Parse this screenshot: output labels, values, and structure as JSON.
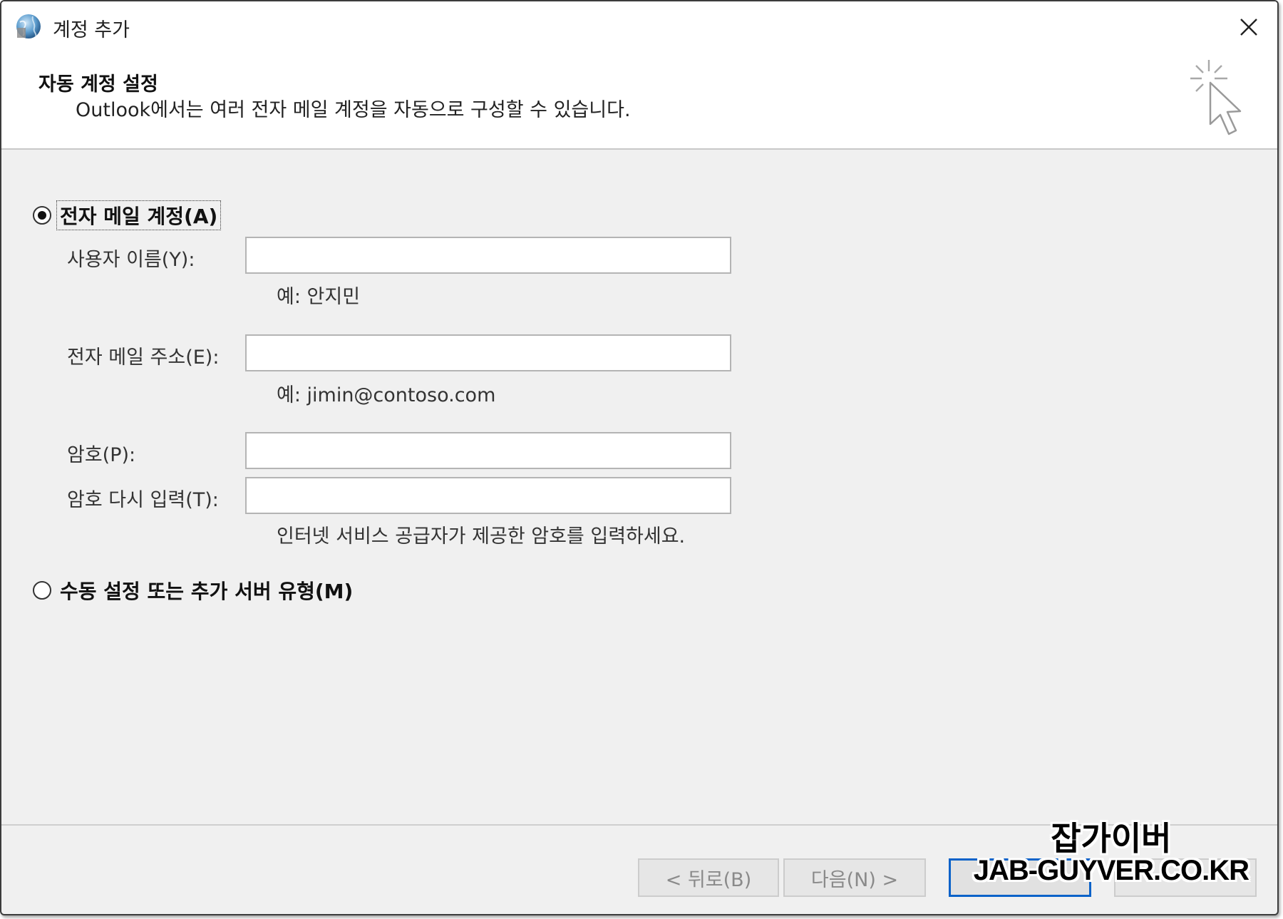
{
  "window": {
    "title": "계정 추가"
  },
  "header": {
    "title": "자동 계정 설정",
    "subtitle": "Outlook에서는 여러 전자 메일 계정을 자동으로 구성할 수 있습니다."
  },
  "options": {
    "email_account": {
      "label": "전자 메일 계정(A)",
      "checked": true
    },
    "manual": {
      "label": "수동 설정 또는 추가 서버 유형(M)",
      "checked": false
    }
  },
  "form": {
    "name": {
      "label": "사용자 이름(Y):",
      "value": "",
      "hint": "예: 안지민"
    },
    "email": {
      "label": "전자 메일 주소(E):",
      "value": "",
      "hint": "예: jimin@contoso.com"
    },
    "password": {
      "label": "암호(P):",
      "value": ""
    },
    "password_confirm": {
      "label": "암호 다시 입력(T):",
      "value": "",
      "hint": "인터넷 서비스 공급자가 제공한 암호를 입력하세요."
    }
  },
  "footer": {
    "back_label": "< 뒤로(B)",
    "next_label": "다음(N) >"
  },
  "watermark": {
    "korean": "잡가이버",
    "url": "JAB-GUYVER.CO.KR"
  },
  "colors": {
    "focus_border": "#0a62c9",
    "dialog_bg": "#f0f0f0"
  },
  "icons": {
    "app": "outlook-globe-icon",
    "close": "close-icon",
    "wizard": "magic-cursor-icon"
  }
}
